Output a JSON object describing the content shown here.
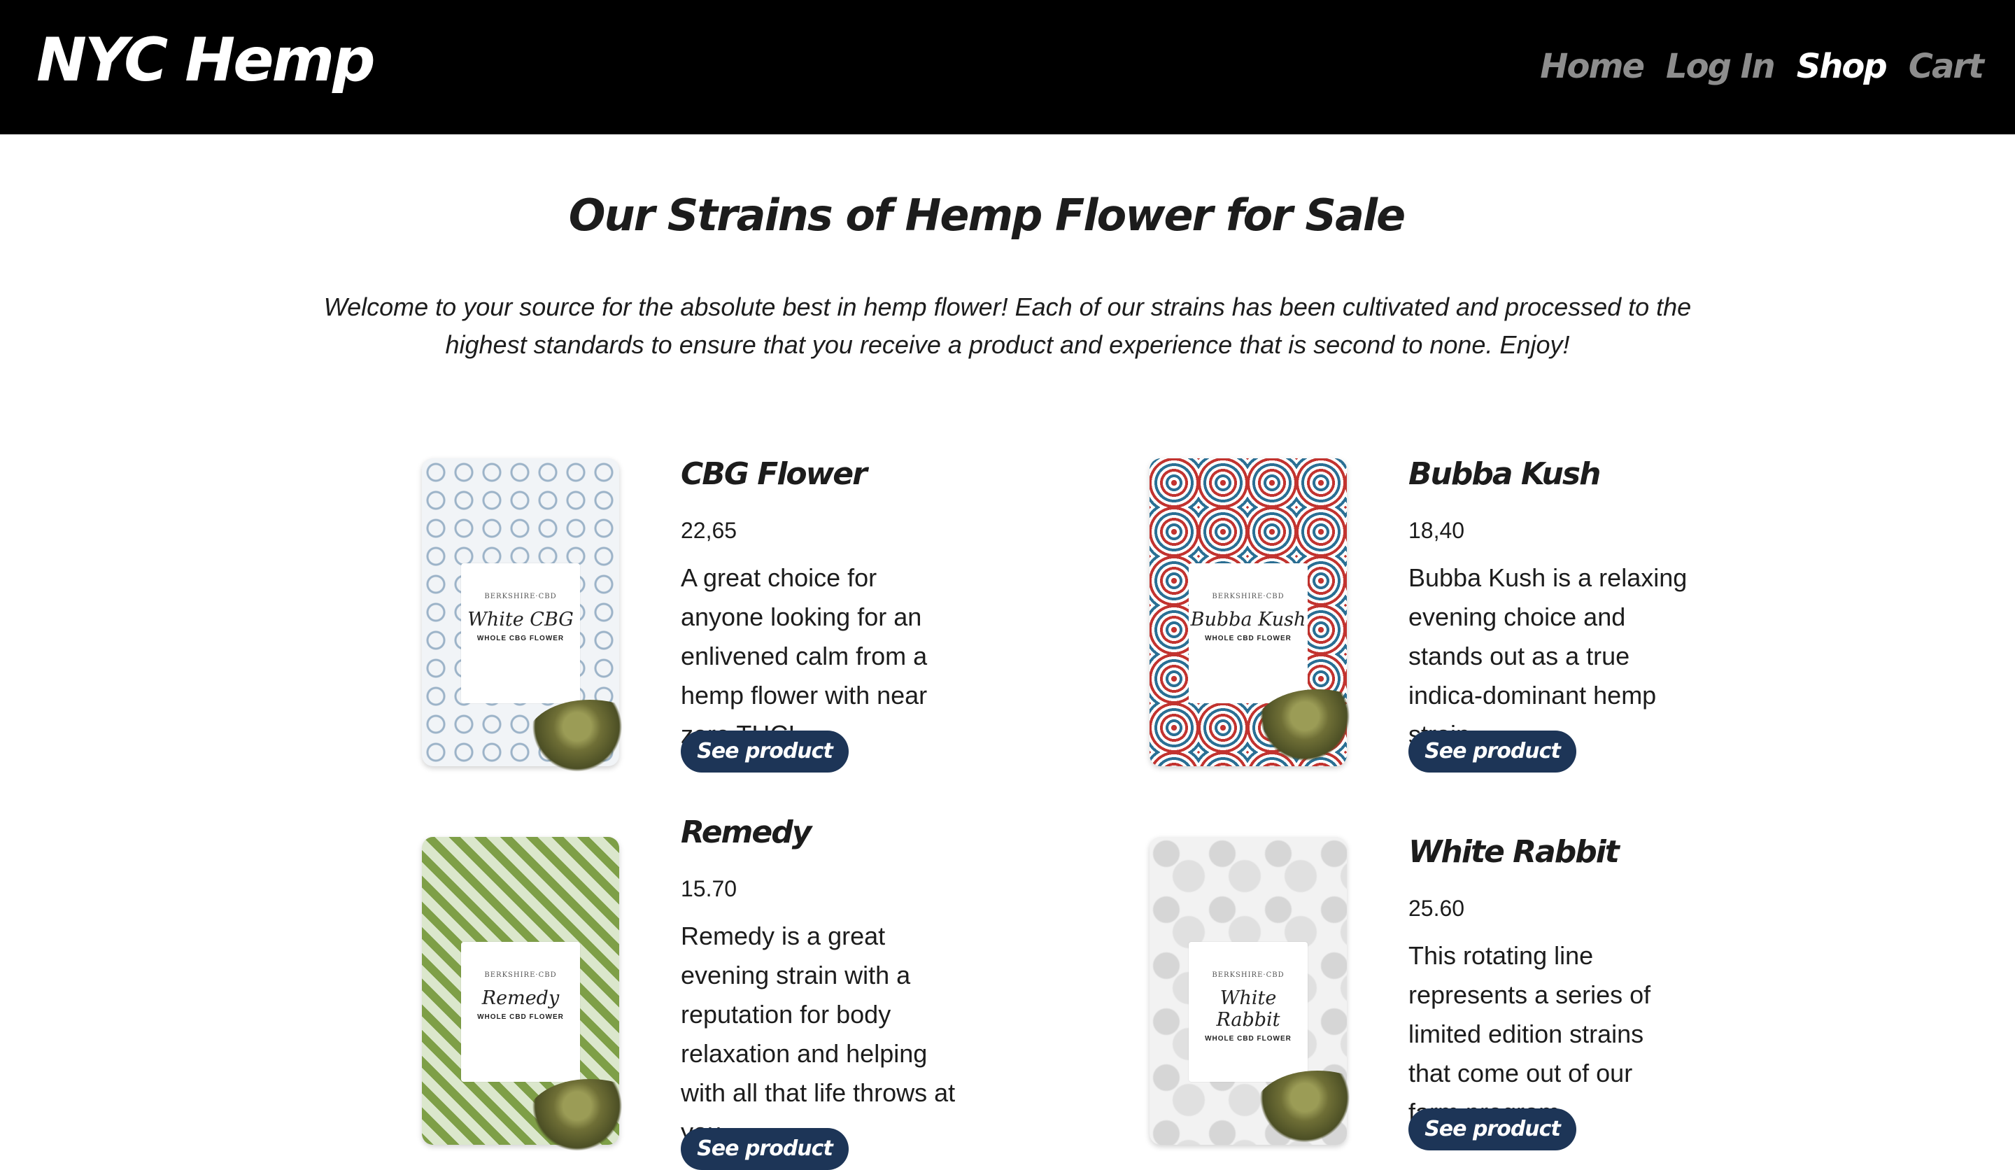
{
  "header": {
    "logo": "NYC Hemp",
    "nav": [
      {
        "label": "Home",
        "active": false
      },
      {
        "label": "Log In",
        "active": false
      },
      {
        "label": "Shop",
        "active": true
      },
      {
        "label": "Cart",
        "active": false
      }
    ]
  },
  "main": {
    "title": "Our Strains of Hemp Flower for Sale",
    "intro": "Welcome to your source for the absolute best in hemp flower! Each of our strains has been cultivated and processed to the highest standards to ensure that you receive a product and experience that is second to none. Enjoy!",
    "products": [
      {
        "name": "CBG Flower",
        "price": "22,65",
        "description": "A great choice for anyone looking for an enlivened calm from a hemp flower with near zero THC!",
        "button": "See product",
        "package": {
          "brand": "BERKSHIRE·CBD",
          "name": "White CBG",
          "subtitle": "WHOLE CBG FLOWER"
        }
      },
      {
        "name": "Bubba Kush",
        "price": "18,40",
        "description": "Bubba Kush is a relaxing evening choice and stands out as a true indica-dominant hemp strain.",
        "button": "See product",
        "package": {
          "brand": "BERKSHIRE·CBD",
          "name": "Bubba Kush",
          "subtitle": "WHOLE CBD FLOWER"
        }
      },
      {
        "name": "Remedy",
        "price": "15.70",
        "description": "Remedy is a great evening strain with a reputation for body relaxation and helping with all that life throws at you.",
        "button": "See product",
        "package": {
          "brand": "BERKSHIRE·CBD",
          "name": "Remedy",
          "subtitle": "WHOLE CBD FLOWER"
        }
      },
      {
        "name": "White Rabbit",
        "price": "25.60",
        "description": "This rotating line represents a series of limited edition strains that come out of our farm program.",
        "button": "See product",
        "package": {
          "brand": "BERKSHIRE·CBD",
          "name": "White Rabbit",
          "subtitle": "WHOLE CBD FLOWER"
        }
      }
    ]
  }
}
